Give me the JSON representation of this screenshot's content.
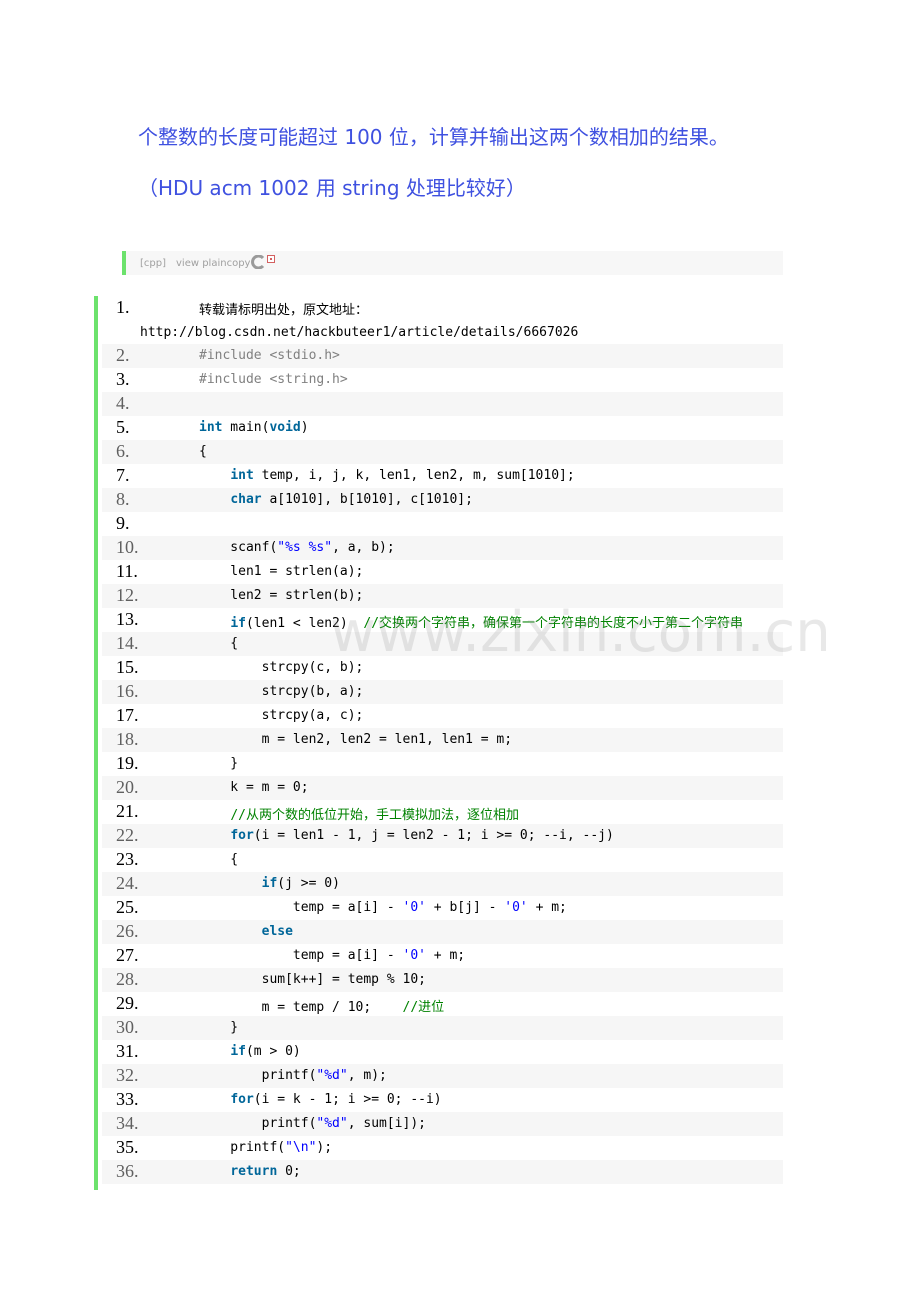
{
  "intro": {
    "line1": "个整数的长度可能超过 100 位，计算并输出这两个数相加的结果。",
    "line2": "（HDU acm 1002  用 string 处理比较好）"
  },
  "toolbar": {
    "lang": "[cpp]",
    "view_plain": "view plaincopy",
    "icons": [
      "copy-icon",
      "print-icon"
    ]
  },
  "watermark": "www.zixin.com.cn",
  "code": {
    "lines": [
      {
        "n": "1.",
        "segments": [
          {
            "t": "转载请标明出处，原文地址："
          }
        ],
        "url": "http://blog.csdn.net/hackbuteer1/article/details/6667026"
      },
      {
        "n": "2.",
        "segments": [
          {
            "t": "#include <stdio.h>",
            "c": "pp"
          }
        ]
      },
      {
        "n": "3.",
        "segments": [
          {
            "t": "#include <string.h>",
            "c": "pp"
          }
        ]
      },
      {
        "n": "4.",
        "segments": []
      },
      {
        "n": "5.",
        "segments": [
          {
            "t": "int",
            "c": "kw"
          },
          {
            "t": " main("
          },
          {
            "t": "void",
            "c": "kw"
          },
          {
            "t": ")"
          }
        ]
      },
      {
        "n": "6.",
        "segments": [
          {
            "t": "{"
          }
        ]
      },
      {
        "n": "7.",
        "segments": [
          {
            "t": "    "
          },
          {
            "t": "int",
            "c": "kw"
          },
          {
            "t": " temp, i, j, k, len1, len2, m, sum[1010];"
          }
        ]
      },
      {
        "n": "8.",
        "segments": [
          {
            "t": "    "
          },
          {
            "t": "char",
            "c": "kw"
          },
          {
            "t": " a[1010], b[1010], c[1010];"
          }
        ]
      },
      {
        "n": "9.",
        "segments": []
      },
      {
        "n": "10.",
        "segments": [
          {
            "t": "    scanf("
          },
          {
            "t": "\"%s %s\"",
            "c": "str"
          },
          {
            "t": ", a, b);"
          }
        ]
      },
      {
        "n": "11.",
        "segments": [
          {
            "t": "    len1 = strlen(a);"
          }
        ]
      },
      {
        "n": "12.",
        "segments": [
          {
            "t": "    len2 = strlen(b);"
          }
        ]
      },
      {
        "n": "13.",
        "segments": [
          {
            "t": "    "
          },
          {
            "t": "if",
            "c": "kw"
          },
          {
            "t": "(len1 < len2)  "
          },
          {
            "t": "//交换两个字符串，确保第一个字符串的长度不小于第二个字符串",
            "c": "cm"
          }
        ]
      },
      {
        "n": "14.",
        "segments": [
          {
            "t": "    {"
          }
        ]
      },
      {
        "n": "15.",
        "segments": [
          {
            "t": "        strcpy(c, b);"
          }
        ]
      },
      {
        "n": "16.",
        "segments": [
          {
            "t": "        strcpy(b, a);"
          }
        ]
      },
      {
        "n": "17.",
        "segments": [
          {
            "t": "        strcpy(a, c);"
          }
        ]
      },
      {
        "n": "18.",
        "segments": [
          {
            "t": "        m = len2, len2 = len1, len1 = m;"
          }
        ]
      },
      {
        "n": "19.",
        "segments": [
          {
            "t": "    }"
          }
        ]
      },
      {
        "n": "20.",
        "segments": [
          {
            "t": "    k = m = 0;"
          }
        ]
      },
      {
        "n": "21.",
        "segments": [
          {
            "t": "    "
          },
          {
            "t": "//从两个数的低位开始，手工模拟加法，逐位相加",
            "c": "cm"
          }
        ]
      },
      {
        "n": "22.",
        "segments": [
          {
            "t": "    "
          },
          {
            "t": "for",
            "c": "kw"
          },
          {
            "t": "(i = len1 - 1, j = len2 - 1; i >= 0; --i, --j)"
          }
        ]
      },
      {
        "n": "23.",
        "segments": [
          {
            "t": "    {"
          }
        ]
      },
      {
        "n": "24.",
        "segments": [
          {
            "t": "        "
          },
          {
            "t": "if",
            "c": "kw"
          },
          {
            "t": "(j >= 0)"
          }
        ]
      },
      {
        "n": "25.",
        "segments": [
          {
            "t": "            temp = a[i] - "
          },
          {
            "t": "'0'",
            "c": "str"
          },
          {
            "t": " + b[j] - "
          },
          {
            "t": "'0'",
            "c": "str"
          },
          {
            "t": " + m;"
          }
        ]
      },
      {
        "n": "26.",
        "segments": [
          {
            "t": "        "
          },
          {
            "t": "else",
            "c": "kw"
          }
        ]
      },
      {
        "n": "27.",
        "segments": [
          {
            "t": "            temp = a[i] - "
          },
          {
            "t": "'0'",
            "c": "str"
          },
          {
            "t": " + m;"
          }
        ]
      },
      {
        "n": "28.",
        "segments": [
          {
            "t": "        sum[k++] = temp % 10;"
          }
        ]
      },
      {
        "n": "29.",
        "segments": [
          {
            "t": "        m = temp / 10;    "
          },
          {
            "t": "//进位",
            "c": "cm"
          }
        ]
      },
      {
        "n": "30.",
        "segments": [
          {
            "t": "    }"
          }
        ]
      },
      {
        "n": "31.",
        "segments": [
          {
            "t": "    "
          },
          {
            "t": "if",
            "c": "kw"
          },
          {
            "t": "(m > 0)"
          }
        ]
      },
      {
        "n": "32.",
        "segments": [
          {
            "t": "        printf("
          },
          {
            "t": "\"%d\"",
            "c": "str"
          },
          {
            "t": ", m);"
          }
        ]
      },
      {
        "n": "33.",
        "segments": [
          {
            "t": "    "
          },
          {
            "t": "for",
            "c": "kw"
          },
          {
            "t": "(i = k - 1; i >= 0; --i)"
          }
        ]
      },
      {
        "n": "34.",
        "segments": [
          {
            "t": "        printf("
          },
          {
            "t": "\"%d\"",
            "c": "str"
          },
          {
            "t": ", sum[i]);"
          }
        ]
      },
      {
        "n": "35.",
        "segments": [
          {
            "t": "    printf("
          },
          {
            "t": "\"\\n\"",
            "c": "str"
          },
          {
            "t": ");"
          }
        ]
      },
      {
        "n": "36.",
        "segments": [
          {
            "t": "    "
          },
          {
            "t": "return",
            "c": "kw"
          },
          {
            "t": " 0;"
          }
        ]
      }
    ]
  }
}
